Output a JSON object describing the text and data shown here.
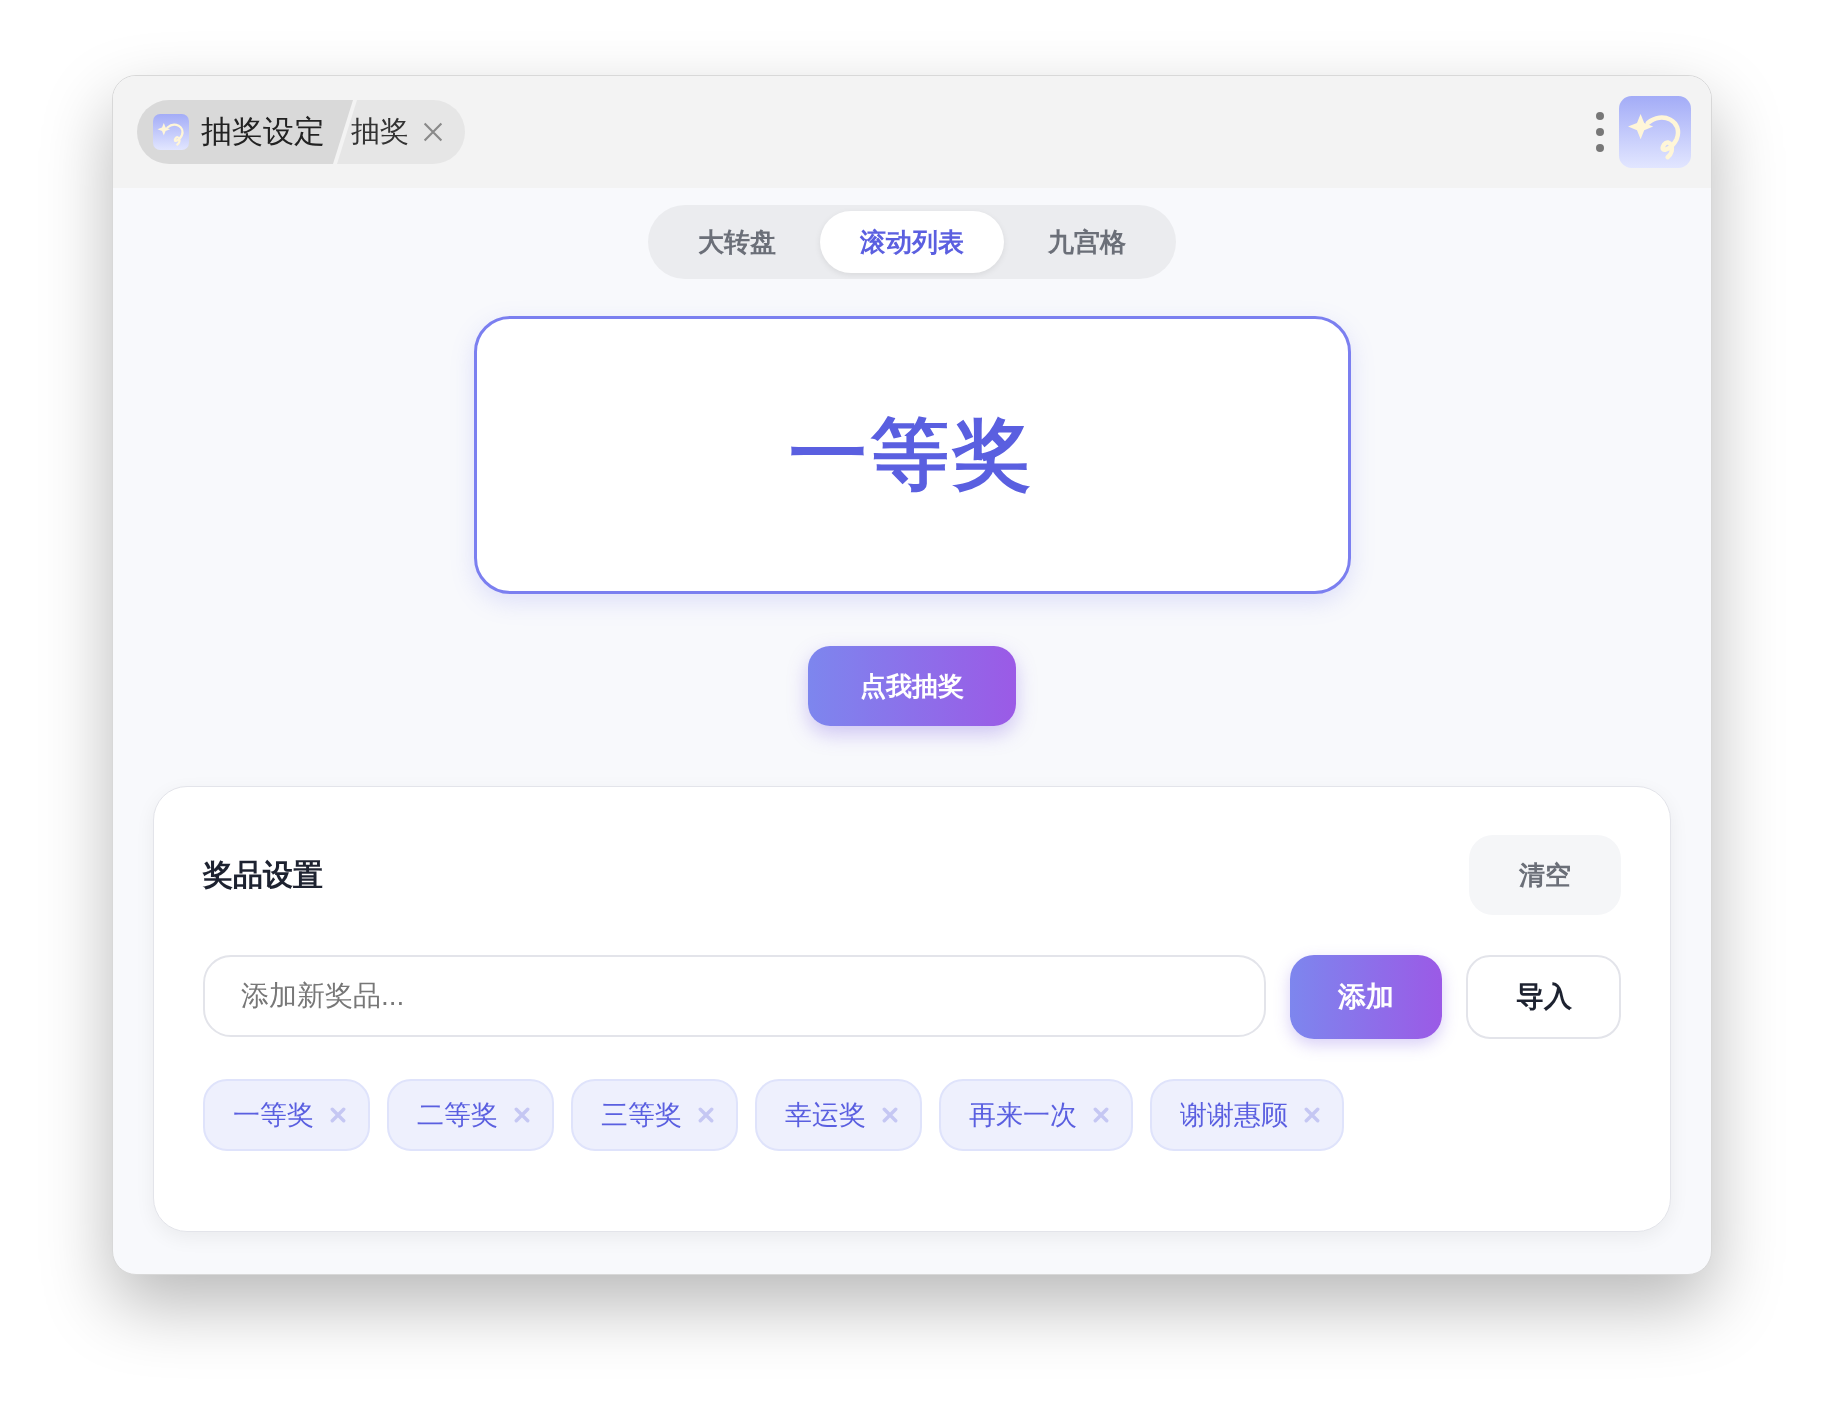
{
  "title_tabs": [
    {
      "label": "抽奖设定",
      "selected": true,
      "has_icon": true,
      "closable": false
    },
    {
      "label": "抽奖",
      "selected": false,
      "has_icon": false,
      "closable": true
    }
  ],
  "modes": [
    {
      "label": "大转盘",
      "selected": false
    },
    {
      "label": "滚动列表",
      "selected": true
    },
    {
      "label": "九宫格",
      "selected": false
    }
  ],
  "result": "一等奖",
  "draw_button": "点我抽奖",
  "prize_panel": {
    "title": "奖品设置",
    "clear_button": "清空",
    "input": {
      "placeholder": "添加新奖品..."
    },
    "add_button": "添加",
    "import_button": "导入",
    "prizes": [
      "一等奖",
      "二等奖",
      "三等奖",
      "幸运奖",
      "再来一次",
      "谢谢惠顾"
    ]
  }
}
